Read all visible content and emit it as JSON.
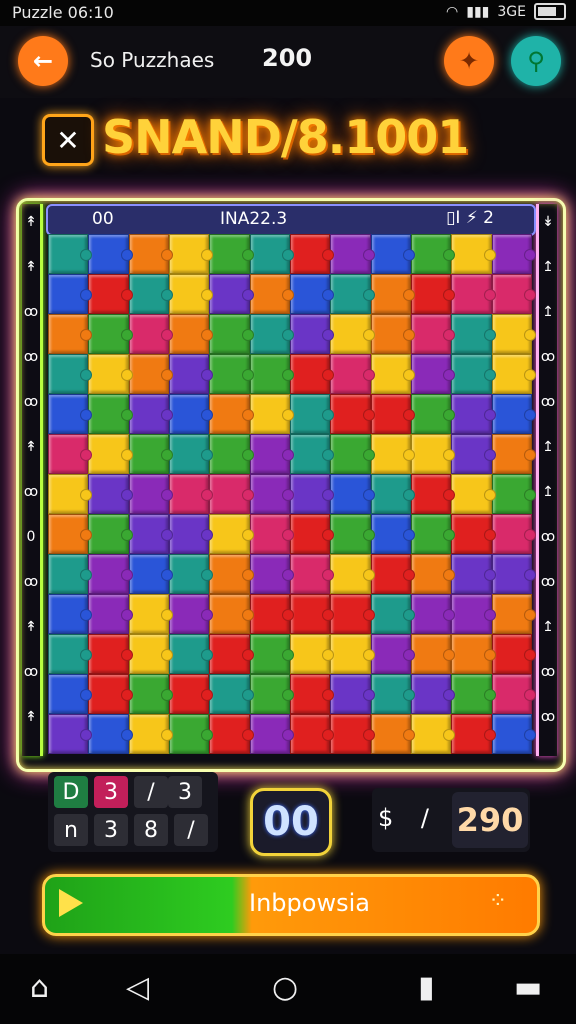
{
  "status_bar": {
    "time": "Puzzle 06:10",
    "signal_text": "3GE"
  },
  "top_bar": {
    "title": "So Puzzhaes",
    "score": "200"
  },
  "icons": {
    "back": "back-arrow-icon",
    "puzzle": "puzzle-piece-icon",
    "search": "search-icon",
    "close": "close-icon",
    "play": "play-icon",
    "home": "home-icon",
    "nav_back": "nav-back-icon",
    "nav_home": "circle-home-icon",
    "recents": "recents-icon"
  },
  "banner": {
    "text": "SNAND/8.1001"
  },
  "board_header": {
    "left": "00",
    "middle": "INA22.3",
    "right": "▯I ⚡ 2"
  },
  "puzzle": {
    "palette": [
      "#e0201f",
      "#f07a12",
      "#f7c61a",
      "#3aa832",
      "#1e9b8c",
      "#2a55d8",
      "#6a35c6",
      "#8a2ab8",
      "#d92a6a"
    ]
  },
  "left_rail": [
    "↟",
    "↟",
    "ꝏ",
    "ꝏ",
    "ꝏ",
    "↟",
    "ꝏ",
    "0",
    "ꝏ",
    "↟",
    "ꝏ",
    "↟"
  ],
  "right_rail": [
    "↡",
    "↥",
    "↥",
    "ꝏ",
    "ꝏ",
    "↥",
    "↥",
    "ꝏ",
    "ꝏ",
    "↥",
    "ꝏ",
    "ꝏ"
  ],
  "stat_left": {
    "row1": [
      "D",
      "3",
      "/",
      "3"
    ],
    "row2": [
      "n",
      "3",
      "8",
      "/"
    ]
  },
  "counter": "00",
  "stat_right": {
    "icons": "$ /",
    "score": "290"
  },
  "action_bar": {
    "label": "Inbpowsia",
    "dots": "⁘"
  }
}
